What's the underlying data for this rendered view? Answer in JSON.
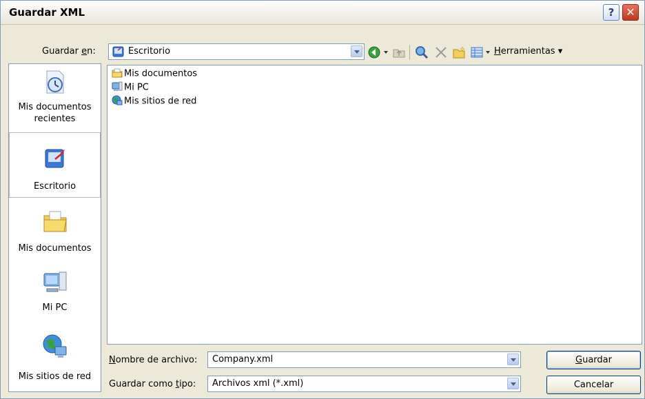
{
  "window": {
    "title": "Guardar XML",
    "help_glyph": "?",
    "close_glyph": "✕"
  },
  "toolbar": {
    "save_in_label_prefix": "Guardar ",
    "save_in_label_key": "e",
    "save_in_label_suffix": "n:",
    "location": "Escritorio",
    "tools_prefix": "",
    "tools_key": "H",
    "tools_suffix": "erramientas",
    "tools_caret": "▾",
    "icons": [
      "back-icon",
      "up-folder-icon",
      "search-web-icon",
      "delete-icon",
      "new-folder-icon",
      "views-icon"
    ]
  },
  "places": [
    {
      "label": "Mis documentos recientes",
      "icon": "recent-documents-icon"
    },
    {
      "label": "Escritorio",
      "icon": "desktop-icon",
      "selected": true
    },
    {
      "label": "Mis documentos",
      "icon": "my-documents-icon"
    },
    {
      "label": "Mi PC",
      "icon": "my-computer-icon"
    },
    {
      "label": "Mis sitios de red",
      "icon": "network-places-icon"
    }
  ],
  "files": [
    {
      "name": "Mis documentos",
      "icon": "folder-icon"
    },
    {
      "name": "Mi PC",
      "icon": "computer-icon"
    },
    {
      "name": "Mis sitios de red",
      "icon": "network-icon"
    }
  ],
  "form": {
    "filename_label_key": "N",
    "filename_label_rest": "ombre de archivo:",
    "filename_value": "Company.xml",
    "type_label_prefix": "Guardar como ",
    "type_label_key": "t",
    "type_label_suffix": "ipo:",
    "type_value": "Archivos xml (*.xml)"
  },
  "buttons": {
    "save_key": "G",
    "save_rest": "uardar",
    "cancel": "Cancelar"
  }
}
